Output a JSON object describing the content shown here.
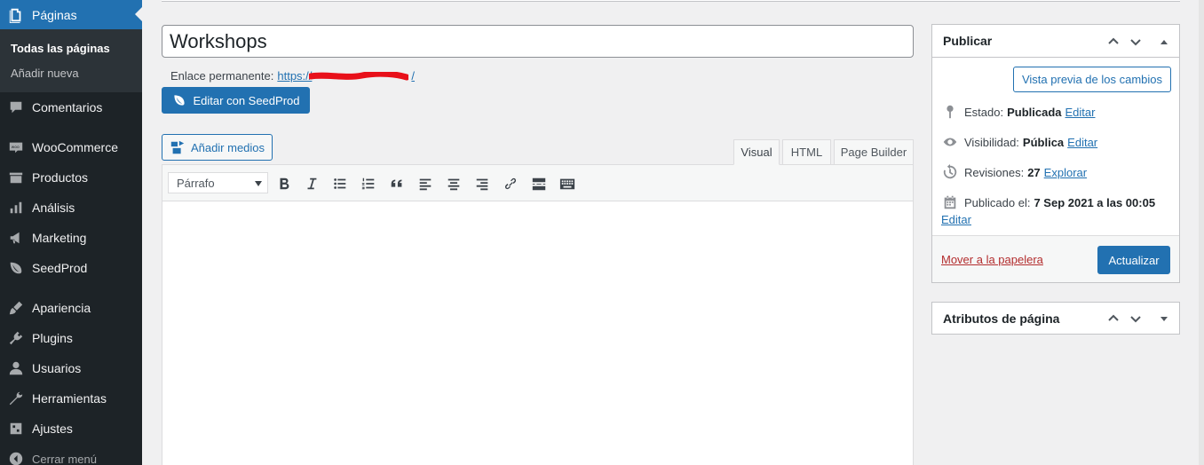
{
  "sidebar": {
    "items": [
      {
        "label": "Páginas",
        "icon": "pages-icon"
      },
      {
        "label": "Comentarios",
        "icon": "comments-icon"
      },
      {
        "label": "WooCommerce",
        "icon": "woocommerce-icon"
      },
      {
        "label": "Productos",
        "icon": "products-icon"
      },
      {
        "label": "Análisis",
        "icon": "analytics-icon"
      },
      {
        "label": "Marketing",
        "icon": "megaphone-icon"
      },
      {
        "label": "SeedProd",
        "icon": "seedprod-leaf-icon"
      },
      {
        "label": "Apariencia",
        "icon": "paintbrush-icon"
      },
      {
        "label": "Plugins",
        "icon": "plug-icon"
      },
      {
        "label": "Usuarios",
        "icon": "users-icon"
      },
      {
        "label": "Herramientas",
        "icon": "wrench-icon"
      },
      {
        "label": "Ajustes",
        "icon": "settings-icon"
      }
    ],
    "submenu": [
      "Todas las páginas",
      "Añadir nueva"
    ],
    "collapse_label": "Cerrar menú"
  },
  "editor": {
    "title_value": "Workshops",
    "permalink_label": "Enlace permanente:",
    "permalink_url": "https://",
    "permalink_tail": "/",
    "seedprod_button": "Editar con SeedProd",
    "add_media_button": "Añadir medios",
    "tabs": [
      "Visual",
      "HTML",
      "Page Builder"
    ],
    "active_tab": "Visual",
    "format_select": "Párrafo",
    "toolbar_icons": [
      "bold-icon",
      "italic-icon",
      "bullet-list-icon",
      "numbered-list-icon",
      "blockquote-icon",
      "align-left-icon",
      "align-center-icon",
      "align-right-icon",
      "link-icon",
      "read-more-icon",
      "toolbar-toggle-icon"
    ]
  },
  "publish": {
    "title": "Publicar",
    "preview_button": "Vista previa de los cambios",
    "status_label": "Estado:",
    "status_value": "Publicada",
    "visibility_label": "Visibilidad:",
    "visibility_value": "Pública",
    "revisions_label": "Revisiones:",
    "revisions_value": "27",
    "published_label": "Publicado el:",
    "published_value": "7 Sep 2021 a las 00:05",
    "edit_link": "Editar",
    "explore_link": "Explorar",
    "trash_link": "Mover a la papelera",
    "update_button": "Actualizar"
  },
  "attributes": {
    "title": "Atributos de página"
  },
  "colors": {
    "sidebar_bg": "#1d2327",
    "accent": "#2271b1",
    "trash": "#b32d2e",
    "redaction": "#e8101a"
  }
}
